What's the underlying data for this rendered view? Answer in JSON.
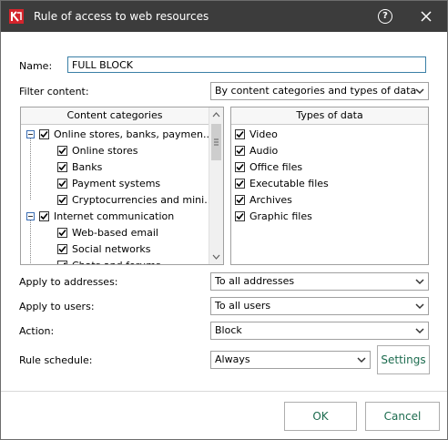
{
  "window": {
    "title": "Rule of access to web resources",
    "help_label": "?",
    "colors": {
      "titlebar": "#3c3c3c",
      "accent": "#1c6b4e",
      "app_icon": "#d4242c"
    }
  },
  "form": {
    "name_label": "Name:",
    "name_value": "FULL BLOCK",
    "filter_label": "Filter content:",
    "filter_value": "By content categories and types of data",
    "addresses_label": "Apply to addresses:",
    "addresses_value": "To all addresses",
    "users_label": "Apply to users:",
    "users_value": "To all users",
    "action_label": "Action:",
    "action_value": "Block",
    "schedule_label": "Rule schedule:",
    "schedule_value": "Always",
    "settings_label": "Settings"
  },
  "categories": {
    "header": "Content categories",
    "items": [
      {
        "label": "Online stores, banks, paymen...",
        "level": 0,
        "checked": true
      },
      {
        "label": "Online stores",
        "level": 1,
        "checked": true
      },
      {
        "label": "Banks",
        "level": 1,
        "checked": true
      },
      {
        "label": "Payment systems",
        "level": 1,
        "checked": true
      },
      {
        "label": "Cryptocurrencies and mini...",
        "level": 1,
        "checked": true
      },
      {
        "label": "Internet communication",
        "level": 0,
        "checked": true
      },
      {
        "label": "Web-based email",
        "level": 1,
        "checked": true
      },
      {
        "label": "Social networks",
        "level": 1,
        "checked": true
      },
      {
        "label": "Chats and forums",
        "level": 1,
        "checked": true
      }
    ]
  },
  "data_types": {
    "header": "Types of data",
    "items": [
      {
        "label": "Video",
        "checked": true
      },
      {
        "label": "Audio",
        "checked": true
      },
      {
        "label": "Office files",
        "checked": true
      },
      {
        "label": "Executable files",
        "checked": true
      },
      {
        "label": "Archives",
        "checked": true
      },
      {
        "label": "Graphic files",
        "checked": true
      }
    ]
  },
  "footer": {
    "ok_label": "OK",
    "cancel_label": "Cancel"
  }
}
